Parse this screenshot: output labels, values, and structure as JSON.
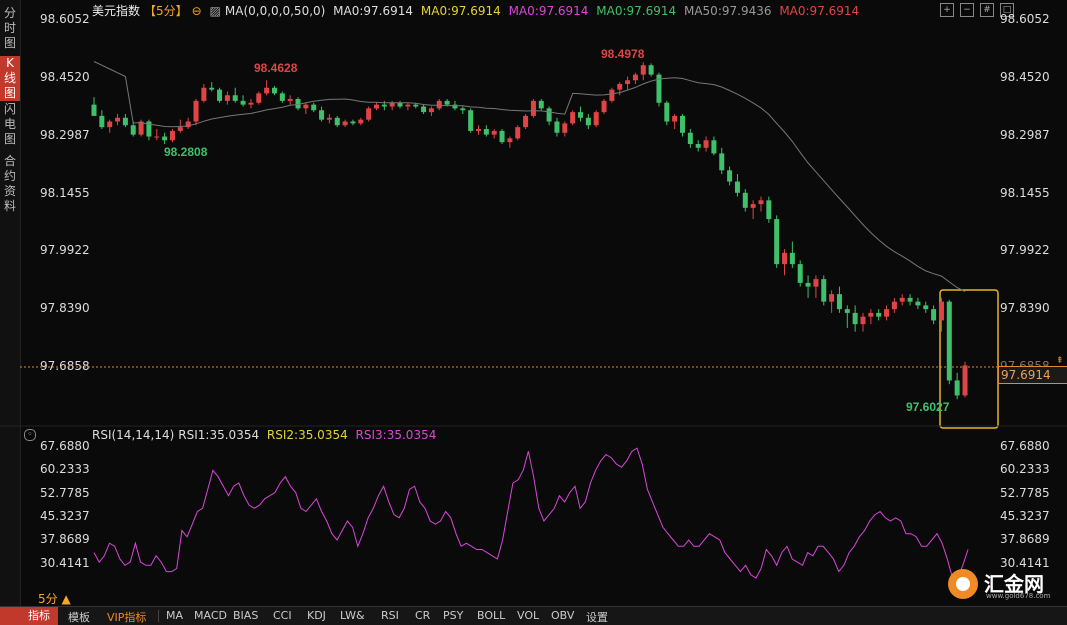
{
  "sidebar": {
    "tabs": [
      {
        "label": "分时图",
        "active": false
      },
      {
        "label": "K线图",
        "active": true
      },
      {
        "label": "闪电图",
        "active": false
      },
      {
        "label": "合约资料",
        "active": false
      }
    ]
  },
  "header": {
    "symbol": "美元指数",
    "period": "【5分】",
    "ma_settings": "MA(0,0,0,0,50,0)",
    "ma_values": [
      {
        "text": "MA0:97.6914",
        "color": "#dddddd"
      },
      {
        "text": "MA0:97.6914",
        "color": "#e6d230"
      },
      {
        "text": "MA0:97.6914",
        "color": "#d946d9"
      },
      {
        "text": "MA0:97.6914",
        "color": "#3fc06a"
      },
      {
        "text": "MA50:97.9436",
        "color": "#999999"
      },
      {
        "text": "MA0:97.6914",
        "color": "#e04545"
      }
    ]
  },
  "price_axis": {
    "labels": [
      "98.6052",
      "98.4520",
      "98.2987",
      "98.1455",
      "97.9922",
      "97.8390",
      "97.6858"
    ],
    "current_price": "97.6914",
    "right_hidden_label": "97.6858"
  },
  "annotations": {
    "high1": "98.4628",
    "high2": "98.4978",
    "low1": "98.2808",
    "low2": "97.6027"
  },
  "rsi": {
    "title": "RSI(14,14,14)",
    "rsi1": "RSI1:35.0354",
    "rsi2": "RSI2:35.0354",
    "rsi3": "RSI3:35.0354",
    "labels": [
      "67.6880",
      "60.2333",
      "52.7785",
      "45.3237",
      "37.8689",
      "30.4141"
    ],
    "values": [
      34,
      31,
      33,
      37,
      36,
      32,
      30,
      31,
      37,
      31,
      30,
      30,
      33,
      31,
      28,
      28,
      29,
      41,
      39,
      43,
      47,
      48,
      54,
      60,
      58,
      55,
      52,
      55,
      56,
      52,
      49,
      48,
      49,
      51,
      52,
      53,
      56,
      58,
      55,
      53,
      48,
      47,
      49,
      51,
      47,
      44,
      40,
      38,
      41,
      44,
      42,
      36,
      40,
      45,
      48,
      52,
      55,
      50,
      46,
      45,
      48,
      54,
      55,
      50,
      48,
      44,
      43,
      44,
      47,
      45,
      40,
      36,
      37,
      36,
      35,
      35,
      34,
      33,
      32,
      38,
      47,
      56,
      57,
      60,
      66,
      58,
      48,
      44,
      46,
      48,
      52,
      50,
      53,
      55,
      48,
      50,
      56,
      60,
      63,
      65,
      64,
      62,
      61,
      63,
      66,
      67,
      62,
      54,
      50,
      46,
      42,
      40,
      38,
      36,
      36,
      38,
      36,
      36,
      38,
      40,
      39,
      38,
      34,
      32,
      30,
      28,
      30,
      27,
      26,
      29,
      35,
      33,
      30,
      34,
      36,
      32,
      31,
      30,
      34,
      33,
      36,
      36,
      34,
      32,
      28,
      30,
      34,
      36,
      39,
      41,
      44,
      46,
      47,
      45,
      44,
      45,
      44,
      40,
      40,
      39,
      36,
      36,
      38,
      40,
      37,
      32,
      26,
      26,
      30,
      35
    ]
  },
  "chart_data": {
    "type": "candlestick",
    "title": "美元指数",
    "period": "5分",
    "ylim": [
      97.6027,
      98.6052
    ],
    "ma50_last": 97.9436,
    "last_close": 97.6914,
    "candles": [
      [
        98.385,
        98.405,
        98.355,
        98.355
      ],
      [
        98.355,
        98.37,
        98.32,
        98.325
      ],
      [
        98.325,
        98.345,
        98.31,
        98.34
      ],
      [
        98.34,
        98.36,
        98.33,
        98.35
      ],
      [
        98.35,
        98.36,
        98.325,
        98.33
      ],
      [
        98.33,
        98.34,
        98.3,
        98.305
      ],
      [
        98.305,
        98.345,
        98.3,
        98.34
      ],
      [
        98.34,
        98.345,
        98.29,
        98.3
      ],
      [
        98.3,
        98.32,
        98.29,
        98.3
      ],
      [
        98.3,
        98.31,
        98.28,
        98.29
      ],
      [
        98.29,
        98.32,
        98.285,
        98.315
      ],
      [
        98.315,
        98.345,
        98.31,
        98.325
      ],
      [
        98.325,
        98.35,
        98.32,
        98.34
      ],
      [
        98.34,
        98.4,
        98.33,
        98.395
      ],
      [
        98.395,
        98.44,
        98.39,
        98.43
      ],
      [
        98.43,
        98.445,
        98.42,
        98.425
      ],
      [
        98.425,
        98.43,
        98.39,
        98.395
      ],
      [
        98.395,
        98.42,
        98.385,
        98.41
      ],
      [
        98.41,
        98.43,
        98.39,
        98.395
      ],
      [
        98.395,
        98.41,
        98.38,
        98.385
      ],
      [
        98.385,
        98.4,
        98.375,
        98.39
      ],
      [
        98.39,
        98.42,
        98.385,
        98.415
      ],
      [
        98.415,
        98.45,
        98.41,
        98.43
      ],
      [
        98.43,
        98.435,
        98.41,
        98.415
      ],
      [
        98.415,
        98.42,
        98.39,
        98.395
      ],
      [
        98.395,
        98.41,
        98.385,
        98.4
      ],
      [
        98.4,
        98.405,
        98.37,
        98.375
      ],
      [
        98.375,
        98.39,
        98.36,
        98.385
      ],
      [
        98.385,
        98.39,
        98.365,
        98.37
      ],
      [
        98.37,
        98.38,
        98.34,
        98.345
      ],
      [
        98.345,
        98.36,
        98.335,
        98.35
      ],
      [
        98.35,
        98.355,
        98.325,
        98.33
      ],
      [
        98.33,
        98.345,
        98.325,
        98.34
      ],
      [
        98.34,
        98.345,
        98.33,
        98.335
      ],
      [
        98.335,
        98.35,
        98.33,
        98.345
      ],
      [
        98.345,
        98.38,
        98.34,
        98.375
      ],
      [
        98.375,
        98.39,
        98.37,
        98.385
      ],
      [
        98.385,
        98.395,
        98.37,
        98.38
      ],
      [
        98.38,
        98.395,
        98.37,
        98.39
      ],
      [
        98.39,
        98.395,
        98.375,
        98.38
      ],
      [
        98.38,
        98.39,
        98.37,
        98.385
      ],
      [
        98.385,
        98.39,
        98.375,
        98.38
      ],
      [
        98.38,
        98.385,
        98.36,
        98.365
      ],
      [
        98.365,
        98.38,
        98.355,
        98.375
      ],
      [
        98.375,
        98.4,
        98.37,
        98.395
      ],
      [
        98.395,
        98.4,
        98.38,
        98.385
      ],
      [
        98.385,
        98.395,
        98.37,
        98.375
      ],
      [
        98.375,
        98.38,
        98.36,
        98.37
      ],
      [
        98.37,
        98.375,
        98.31,
        98.315
      ],
      [
        98.315,
        98.33,
        98.305,
        98.32
      ],
      [
        98.32,
        98.33,
        98.3,
        98.305
      ],
      [
        98.305,
        98.32,
        98.295,
        98.315
      ],
      [
        98.315,
        98.32,
        98.28,
        98.285
      ],
      [
        98.285,
        98.3,
        98.27,
        98.295
      ],
      [
        98.295,
        98.33,
        98.29,
        98.325
      ],
      [
        98.325,
        98.36,
        98.32,
        98.355
      ],
      [
        98.355,
        98.4,
        98.35,
        98.395
      ],
      [
        98.395,
        98.4,
        98.37,
        98.375
      ],
      [
        98.375,
        98.38,
        98.33,
        98.34
      ],
      [
        98.34,
        98.35,
        98.3,
        98.31
      ],
      [
        98.31,
        98.34,
        98.3,
        98.335
      ],
      [
        98.335,
        98.37,
        98.33,
        98.365
      ],
      [
        98.365,
        98.38,
        98.34,
        98.35
      ],
      [
        98.35,
        98.36,
        98.32,
        98.33
      ],
      [
        98.33,
        98.37,
        98.325,
        98.365
      ],
      [
        98.365,
        98.4,
        98.36,
        98.395
      ],
      [
        98.395,
        98.43,
        98.39,
        98.425
      ],
      [
        98.425,
        98.445,
        98.41,
        98.44
      ],
      [
        98.44,
        98.46,
        98.425,
        98.45
      ],
      [
        98.45,
        98.47,
        98.44,
        98.465
      ],
      [
        98.465,
        98.498,
        98.45,
        98.49
      ],
      [
        98.49,
        98.495,
        98.46,
        98.465
      ],
      [
        98.465,
        98.47,
        98.38,
        98.39
      ],
      [
        98.39,
        98.395,
        98.33,
        98.34
      ],
      [
        98.34,
        98.36,
        98.32,
        98.355
      ],
      [
        98.355,
        98.36,
        98.3,
        98.31
      ],
      [
        98.31,
        98.32,
        98.27,
        98.28
      ],
      [
        98.28,
        98.29,
        98.26,
        98.27
      ],
      [
        98.27,
        98.3,
        98.26,
        98.29
      ],
      [
        98.29,
        98.3,
        98.25,
        98.255
      ],
      [
        98.255,
        98.27,
        98.2,
        98.21
      ],
      [
        98.21,
        98.22,
        98.17,
        98.18
      ],
      [
        98.18,
        98.2,
        98.14,
        98.15
      ],
      [
        98.15,
        98.16,
        98.1,
        98.11
      ],
      [
        98.11,
        98.13,
        98.08,
        98.12
      ],
      [
        98.12,
        98.14,
        98.1,
        98.13
      ],
      [
        98.13,
        98.14,
        98.07,
        98.08
      ],
      [
        98.08,
        98.09,
        97.95,
        97.96
      ],
      [
        97.96,
        98.0,
        97.93,
        97.99
      ],
      [
        97.99,
        98.02,
        97.95,
        97.96
      ],
      [
        97.96,
        97.97,
        97.9,
        97.91
      ],
      [
        97.91,
        97.93,
        97.87,
        97.9
      ],
      [
        97.9,
        97.93,
        97.87,
        97.92
      ],
      [
        97.92,
        97.93,
        97.85,
        97.86
      ],
      [
        97.86,
        97.89,
        97.83,
        97.88
      ],
      [
        97.88,
        97.9,
        97.83,
        97.84
      ],
      [
        97.84,
        97.85,
        97.79,
        97.83
      ],
      [
        97.83,
        97.85,
        97.78,
        97.8
      ],
      [
        97.8,
        97.83,
        97.78,
        97.82
      ],
      [
        97.82,
        97.84,
        97.8,
        97.83
      ],
      [
        97.83,
        97.84,
        97.81,
        97.82
      ],
      [
        97.82,
        97.85,
        97.81,
        97.84
      ],
      [
        97.84,
        97.87,
        97.83,
        97.86
      ],
      [
        97.86,
        97.88,
        97.85,
        97.87
      ],
      [
        97.87,
        97.88,
        97.85,
        97.86
      ],
      [
        97.86,
        97.87,
        97.84,
        97.85
      ],
      [
        97.85,
        97.86,
        97.83,
        97.84
      ],
      [
        97.84,
        97.85,
        97.8,
        97.81
      ],
      [
        97.81,
        97.87,
        97.78,
        97.86
      ],
      [
        97.86,
        97.865,
        97.64,
        97.65
      ],
      [
        97.65,
        97.67,
        97.6,
        97.61
      ],
      [
        97.61,
        97.7,
        97.605,
        97.69
      ]
    ]
  },
  "bottom_bar": {
    "items": [
      "指标",
      "模板",
      "VIP指标",
      "MA",
      "MACD",
      "BIAS",
      "CCI",
      "KDJ",
      "LW&",
      "RSI",
      "CR",
      "PSY",
      "BOLL",
      "VOL",
      "OBV",
      "设置"
    ],
    "period_label": "5分 ▲"
  },
  "logo": {
    "text": "汇金网",
    "url": "www.gold678.com"
  }
}
